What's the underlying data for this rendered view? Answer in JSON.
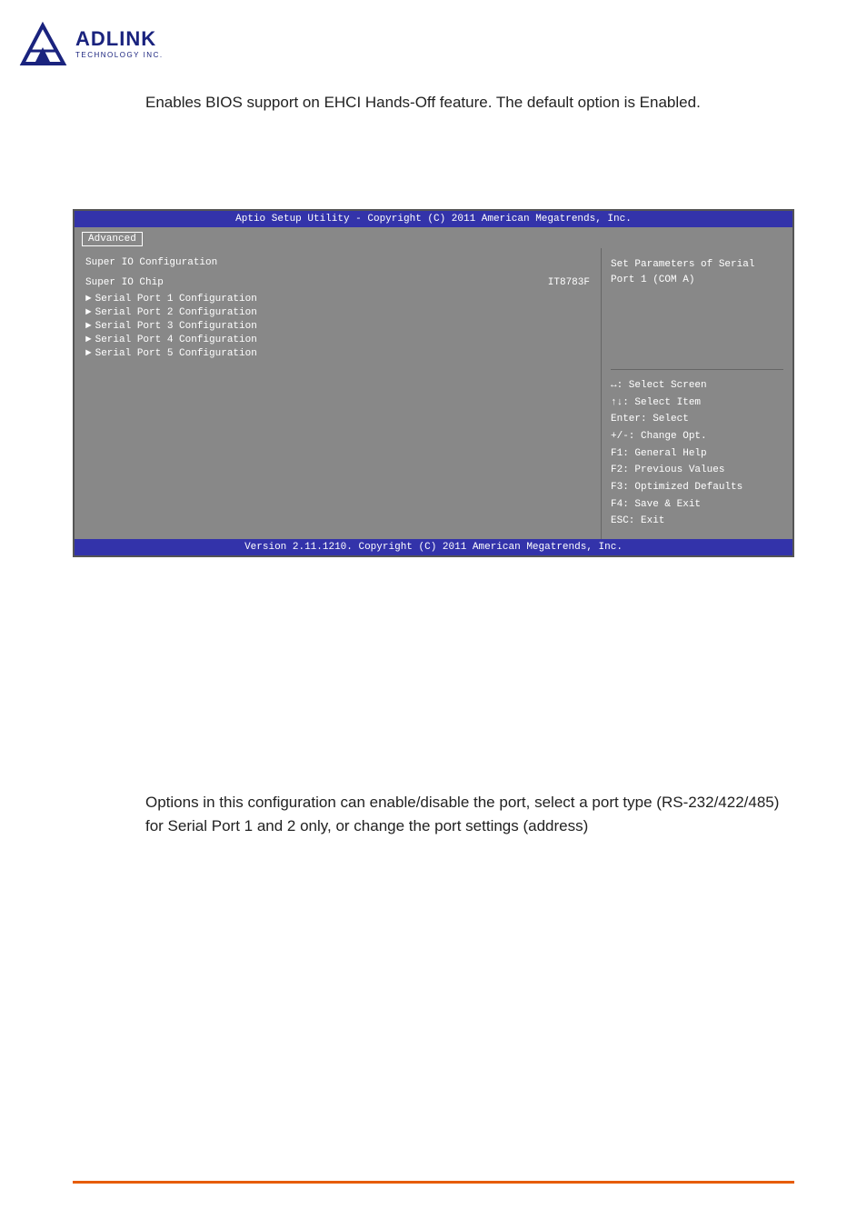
{
  "logo": {
    "adlink_text": "ADLINK",
    "subtitle": "TECHNOLOGY INC."
  },
  "top_description": "Enables BIOS support on EHCI Hands-Off feature. The default option is Enabled.",
  "bios": {
    "titlebar": "Aptio Setup Utility - Copyright (C) 2011 American Megatrends, Inc.",
    "tab_label": "Advanced",
    "section_title": "Super IO Configuration",
    "chip_label": "Super IO Chip",
    "chip_value": "IT8783F",
    "menu_items": [
      "Serial Port 1 Configuration",
      "Serial Port 2 Configuration",
      "Serial Port 3 Configuration",
      "Serial Port 4 Configuration",
      "Serial Port 5 Configuration"
    ],
    "help_text": "Set Parameters of Serial Port 1 (COM A)",
    "key_help": [
      "↔: Select Screen",
      "↑↓: Select Item",
      "Enter: Select",
      "+/-: Change Opt.",
      "F1: General Help",
      "F2: Previous Values",
      "F3: Optimized Defaults",
      "F4: Save & Exit",
      "ESC: Exit"
    ],
    "footer": "Version 2.11.1210. Copyright (C) 2011 American Megatrends, Inc."
  },
  "bottom_description": "Options in this configuration can enable/disable the port, select a port type (RS-232/422/485) for Serial Port 1 and 2 only, or change the port settings (address)"
}
